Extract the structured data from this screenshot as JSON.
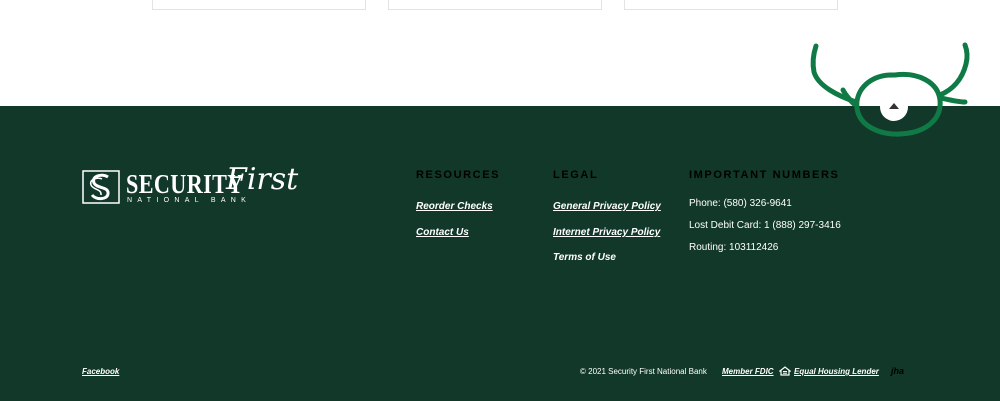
{
  "colors": {
    "footer_bg": "#12382a",
    "doodle": "#0f7a45",
    "text": "#ffffff"
  },
  "logo": {
    "main": "SECURITY",
    "script": "First",
    "sub": "NATIONAL BANK"
  },
  "resources": {
    "title": "RESOURCES",
    "links": [
      "Reorder Checks",
      "Contact Us"
    ]
  },
  "legal": {
    "title": "LEGAL",
    "links": [
      "General Privacy Policy",
      "Internet Privacy Policy",
      "Terms of Use"
    ]
  },
  "important_numbers": {
    "title": "IMPORTANT NUMBERS",
    "lines": [
      "Phone: (580) 326-9641",
      "Lost Debit Card: 1 (888) 297-3416",
      "Routing: 103112426"
    ]
  },
  "bottom": {
    "facebook": "Facebook",
    "copyright": "© 2021 Security First National Bank",
    "member_fdic": "Member FDIC",
    "equal_housing": "Equal Housing Lender",
    "jha": "jha"
  },
  "icons": {
    "back_to_top": "chevron-up-icon",
    "equal_housing": "house-icon"
  }
}
